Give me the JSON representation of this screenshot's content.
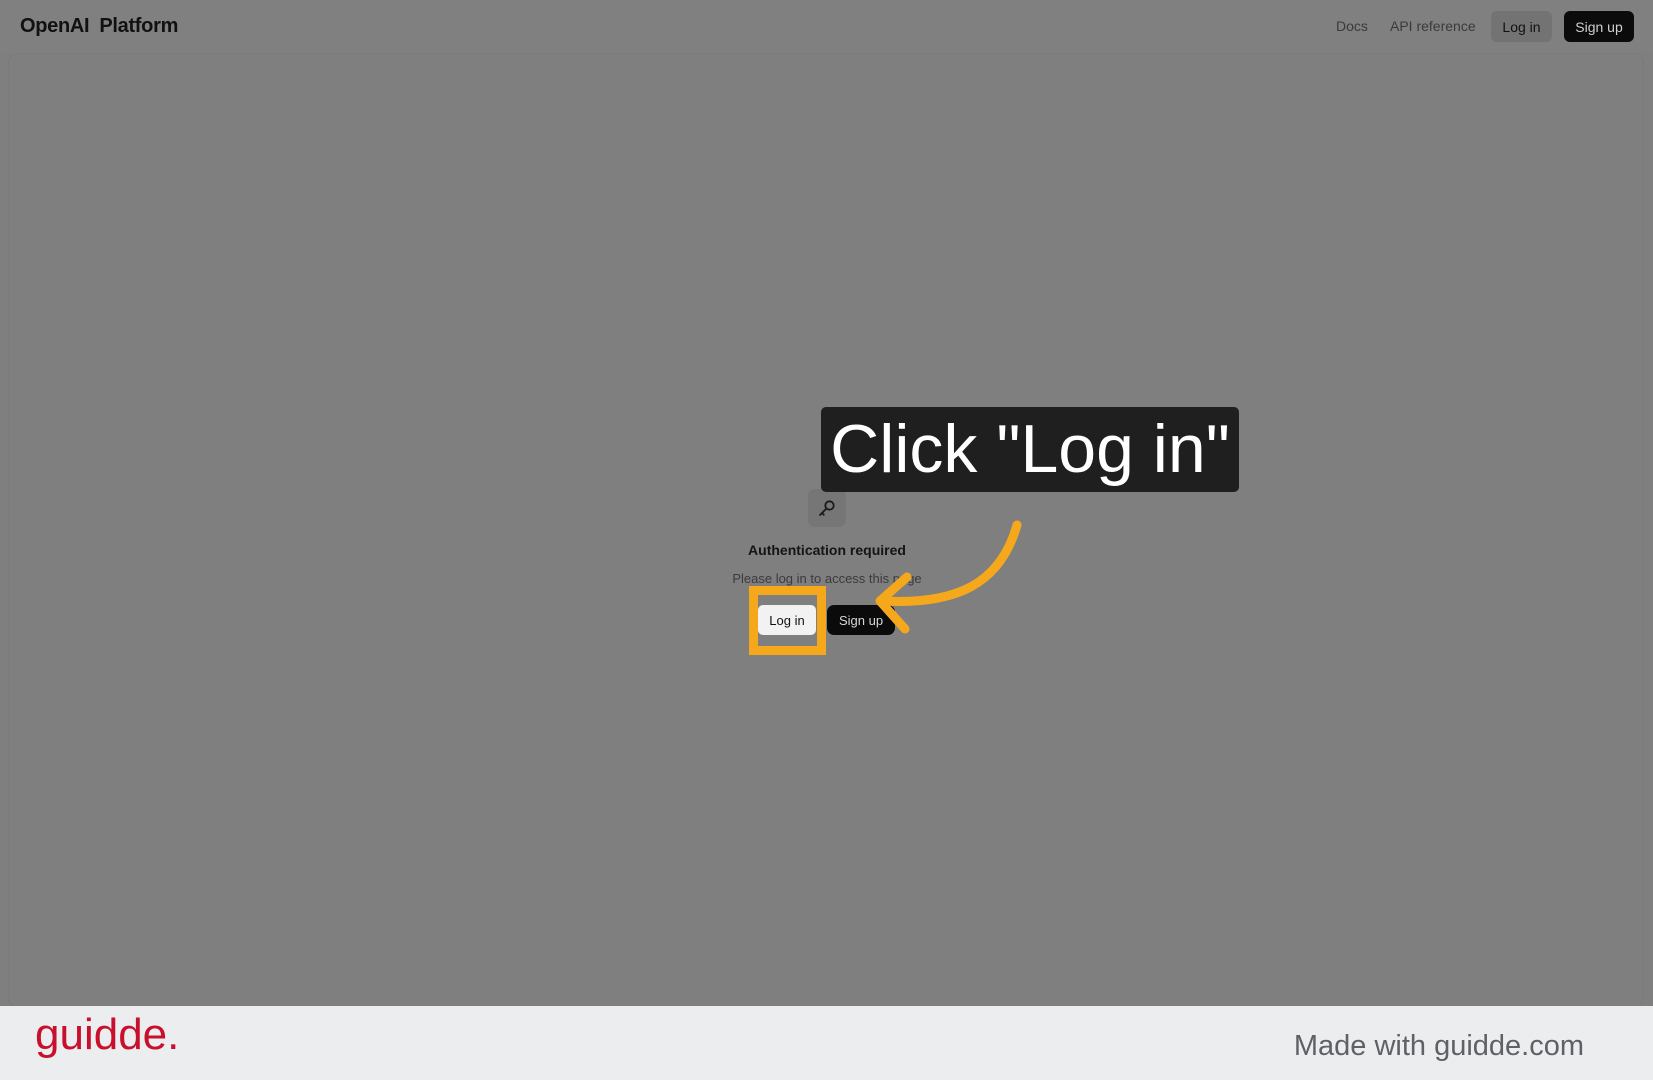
{
  "header": {
    "brand_part1": "OpenAI",
    "brand_part2": "Platform",
    "nav": {
      "docs": "Docs",
      "api_reference": "API reference",
      "login": "Log in",
      "signup": "Sign up"
    }
  },
  "main": {
    "icon": "key-icon",
    "title": "Authentication required",
    "subtitle": "Please log in to access this page",
    "login_button": "Log in",
    "signup_button": "Sign up"
  },
  "overlay": {
    "callout_text": "Click \"Log in\"",
    "accent_color": "#f5a81c",
    "callout_bg": "#1f1f1f"
  },
  "footer": {
    "logo": "guidde.",
    "made_with": "Made with guidde.com",
    "logo_color": "#c8102e"
  }
}
